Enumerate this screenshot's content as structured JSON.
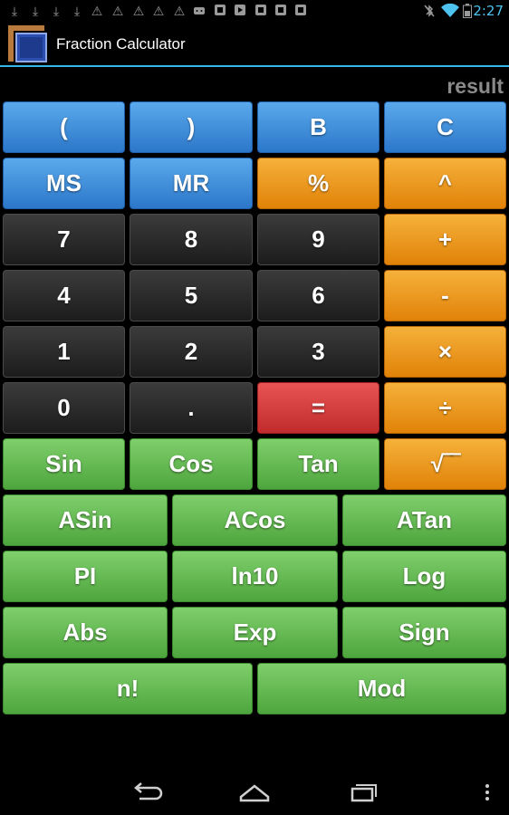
{
  "status_bar": {
    "time": "2:27",
    "icons": [
      "download-icon",
      "download-icon",
      "download-icon",
      "download-icon",
      "warning-icon",
      "warning-icon",
      "warning-icon",
      "warning-icon",
      "warning-icon",
      "android-icon",
      "media-icon",
      "play-icon",
      "media-icon",
      "media-icon",
      "media-icon",
      "bluetooth-off-icon",
      "wifi-icon",
      "battery-icon"
    ]
  },
  "app": {
    "title": "Fraction Calculator"
  },
  "display": {
    "result": "result"
  },
  "keys": {
    "open_paren": "(",
    "close_paren": ")",
    "b": "B",
    "c": "C",
    "ms": "MS",
    "mr": "MR",
    "percent": "%",
    "power": "^",
    "seven": "7",
    "eight": "8",
    "nine": "9",
    "plus": "+",
    "four": "4",
    "five": "5",
    "six": "6",
    "minus": "-",
    "one": "1",
    "two": "2",
    "three": "3",
    "multiply": "×",
    "zero": "0",
    "dot": ".",
    "equals": "=",
    "divide": "÷",
    "sin": "Sin",
    "cos": "Cos",
    "tan": "Tan",
    "sqrt": "√‾‾",
    "asin": "ASin",
    "acos": "ACos",
    "atan": "ATan",
    "pi": "PI",
    "ln10": "ln10",
    "log": "Log",
    "abs": "Abs",
    "exp": "Exp",
    "sign": "Sign",
    "factorial": "n!",
    "mod": "Mod"
  },
  "colors": {
    "accent": "#33b5e5",
    "blue_key": "#3d8fdd",
    "orange_key": "#ee9a1f",
    "dark_key": "#2a2a2a",
    "red_key": "#d63c3c",
    "green_key": "#66bb55"
  }
}
